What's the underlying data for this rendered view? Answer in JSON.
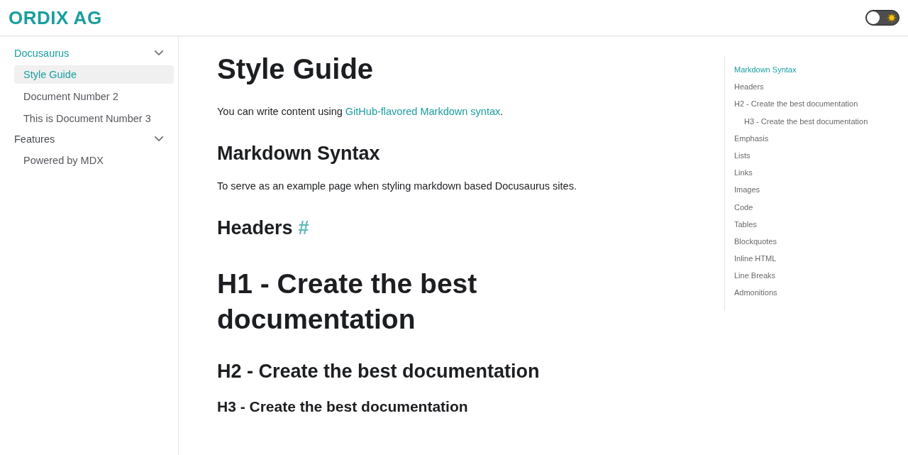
{
  "navbar": {
    "logo": "ORDIX AG",
    "theme_toggle": {
      "on": false
    }
  },
  "sidebar": {
    "categories": [
      {
        "label": "Docusaurus",
        "expanded": true,
        "active": true,
        "items": [
          {
            "label": "Style Guide",
            "selected": true
          },
          {
            "label": "Document Number 2",
            "selected": false
          },
          {
            "label": "This is Document Number 3",
            "selected": false
          }
        ]
      },
      {
        "label": "Features",
        "expanded": true,
        "active": false,
        "items": [
          {
            "label": "Powered by MDX",
            "selected": false
          }
        ]
      }
    ]
  },
  "article": {
    "title": "Style Guide",
    "intro": {
      "before": "You can write content using ",
      "link": "GitHub-flavored Markdown syntax",
      "after": "."
    },
    "blocks": [
      {
        "kind": "h2",
        "text": "Markdown Syntax"
      },
      {
        "kind": "p",
        "text": "To serve as an example page when styling markdown based Docusaurus sites."
      },
      {
        "kind": "h2",
        "text": "Headers",
        "anchor": "#"
      },
      {
        "kind": "h1",
        "text": "H1 - Create the best documentation"
      },
      {
        "kind": "h2",
        "text": "H2 - Create the best documentation"
      },
      {
        "kind": "h3",
        "text": "H3 - Create the best documentation"
      }
    ]
  },
  "toc": [
    {
      "label": "Markdown Syntax",
      "selected": true
    },
    {
      "label": "Headers",
      "selected": false
    },
    {
      "label": "H2 - Create the best documentation",
      "selected": false,
      "children": [
        {
          "label": "H3 - Create the best documentation",
          "selected": false
        }
      ]
    },
    {
      "label": "Emphasis",
      "selected": false
    },
    {
      "label": "Lists",
      "selected": false
    },
    {
      "label": "Links",
      "selected": false
    },
    {
      "label": "Images",
      "selected": false
    },
    {
      "label": "Code",
      "selected": false
    },
    {
      "label": "Tables",
      "selected": false
    },
    {
      "label": "Blockquotes",
      "selected": false
    },
    {
      "label": "Inline HTML",
      "selected": false
    },
    {
      "label": "Line Breaks",
      "selected": false
    },
    {
      "label": "Admonitions",
      "selected": false
    }
  ]
}
